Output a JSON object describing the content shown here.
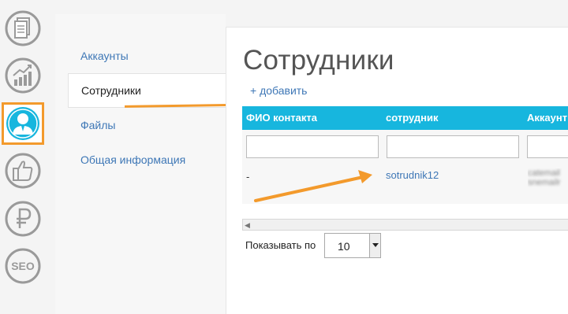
{
  "colors": {
    "accent_orange": "#f39a2c",
    "table_header": "#17b6de",
    "link": "#3e77b6"
  },
  "rail": {
    "icons": [
      {
        "name": "documents-icon"
      },
      {
        "name": "growth-chart-icon"
      },
      {
        "name": "user-icon",
        "active": true
      },
      {
        "name": "thumbs-up-icon"
      },
      {
        "name": "ruble-icon"
      },
      {
        "name": "seo-icon",
        "label": "SEO"
      }
    ]
  },
  "nav": {
    "items": [
      {
        "label": "Аккаунты"
      },
      {
        "label": "Сотрудники",
        "active": true
      },
      {
        "label": "Файлы"
      },
      {
        "label": "Общая информация"
      }
    ]
  },
  "main": {
    "title": "Сотрудники",
    "add_label": "+ добавить",
    "table": {
      "columns": [
        "ФИО контакта",
        "сотрудник",
        "Аккаунт"
      ],
      "rows": [
        {
          "contact": "-",
          "employee": "sotrudnik12",
          "account_line1": "catemail",
          "account_line2": "snemailr"
        }
      ]
    },
    "pager_label": "Показывать по",
    "page_size": "10"
  }
}
